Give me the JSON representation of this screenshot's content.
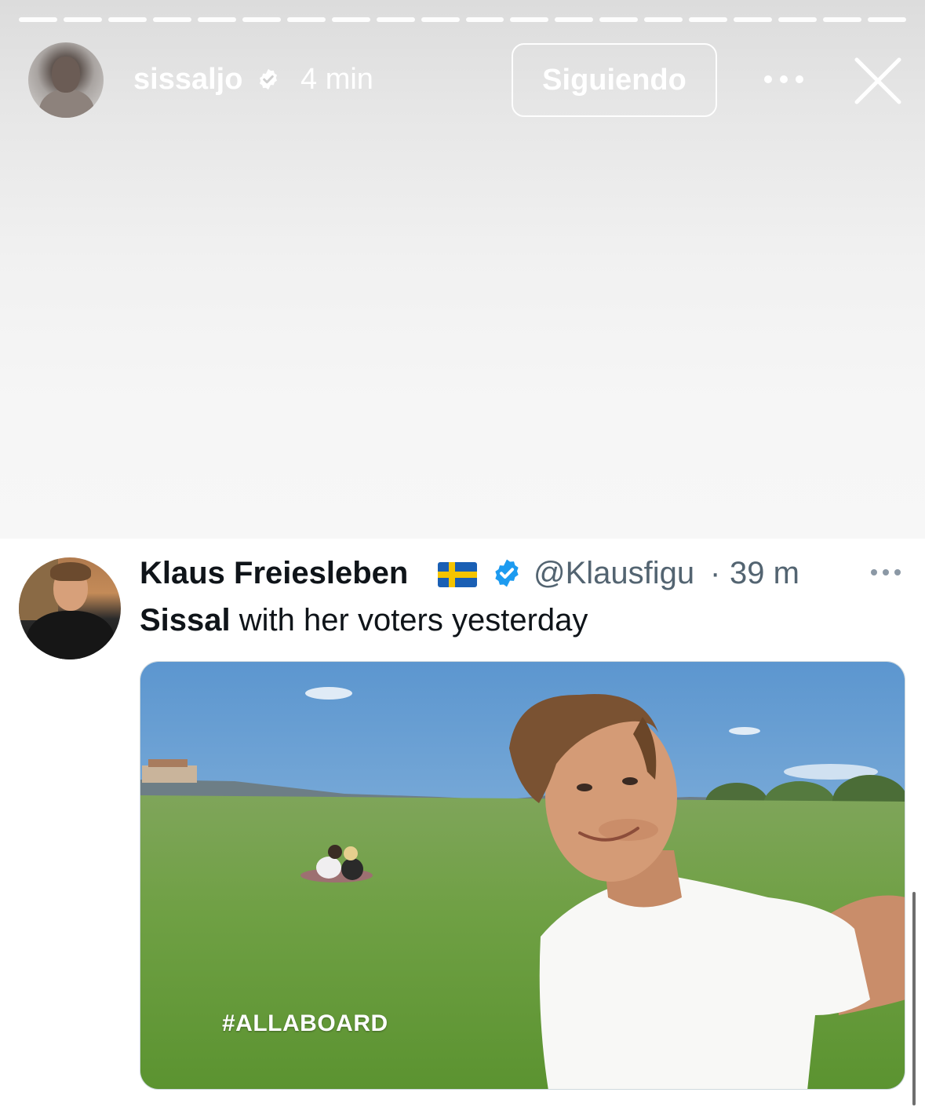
{
  "story": {
    "progress_segments": 20,
    "username": "sissaljo",
    "verified": true,
    "time": "4 min",
    "follow_button": "Siguiendo",
    "icons": {
      "more": "more-horizontal-icon",
      "close": "close-icon",
      "verified": "verified-badge-icon"
    }
  },
  "tweet": {
    "author_name": "Klaus Freiesleben",
    "flag": "sweden-flag",
    "handle": "@Klausfigu",
    "separator": "·",
    "time": "39 m",
    "text_bold": "Sissal",
    "text_rest": " with her voters yesterday",
    "media": {
      "overlay_text": "#ALLABOARD",
      "scene": "selfie-field"
    }
  },
  "colors": {
    "text_primary": "#0f1419",
    "text_secondary": "#536471",
    "verified_blue": "#1d9bf0",
    "story_text": "#ffffff"
  }
}
